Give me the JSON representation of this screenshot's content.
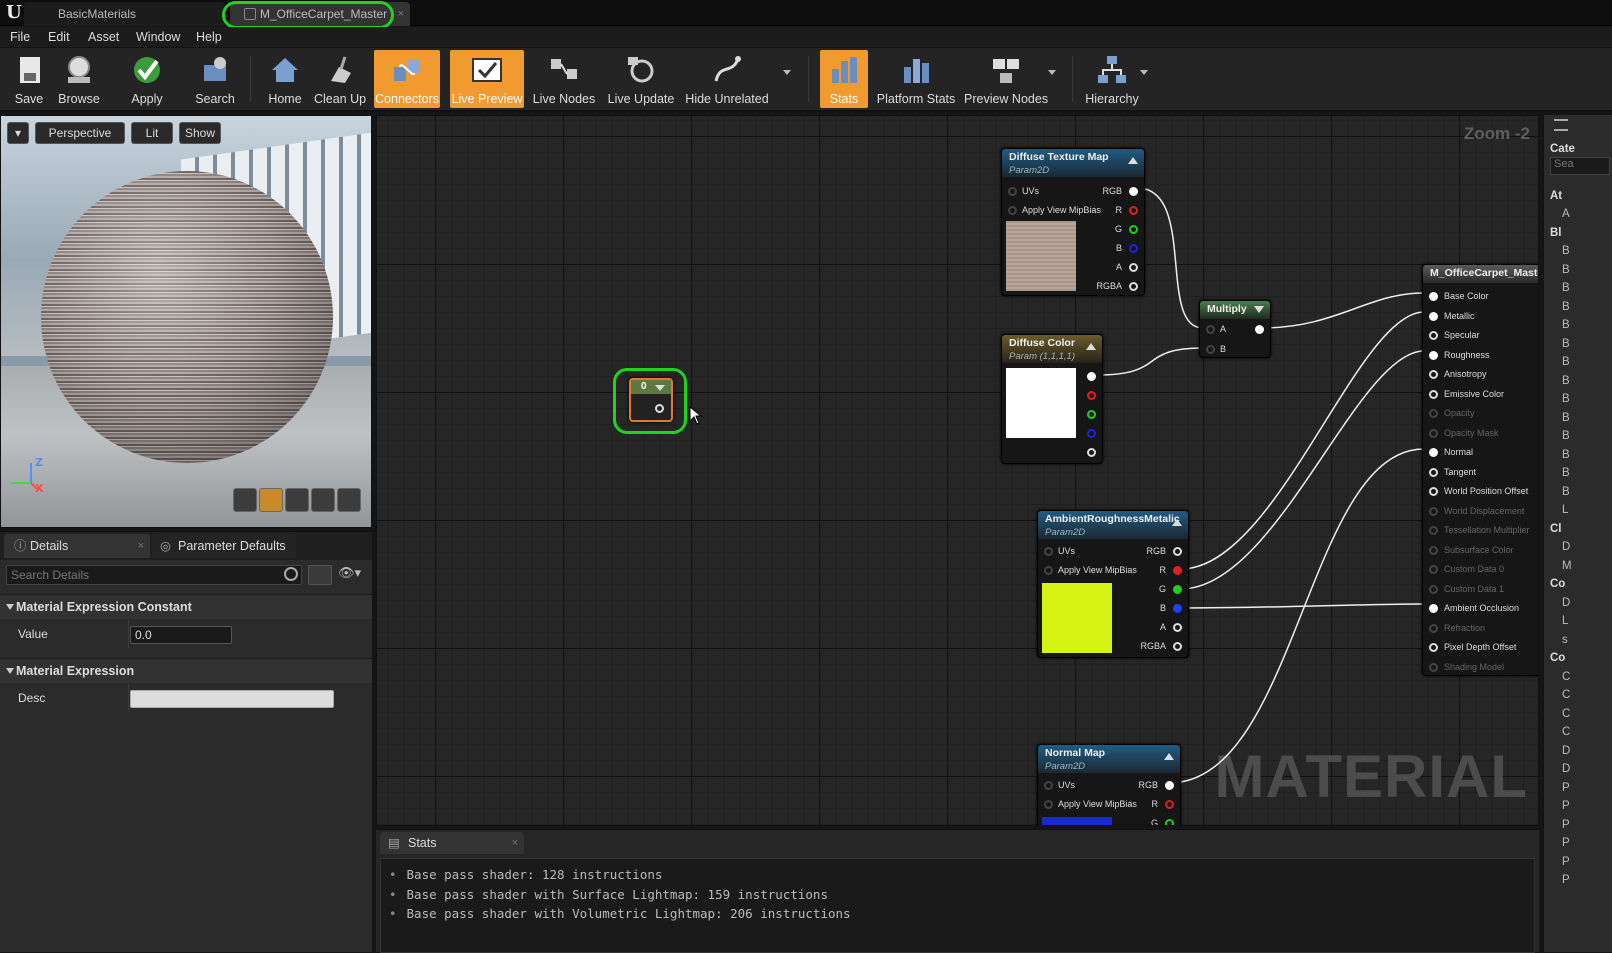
{
  "titlebar": {
    "tab1": "BasicMaterials",
    "tab2": "M_OfficeCarpet_Master",
    "close": "×"
  },
  "menu": [
    "File",
    "Edit",
    "Asset",
    "Window",
    "Help"
  ],
  "toolbar": {
    "save": "Save",
    "browse": "Browse",
    "apply": "Apply",
    "search": "Search",
    "home": "Home",
    "cleanup": "Clean Up",
    "connectors": "Connectors",
    "live_preview": "Live Preview",
    "live_nodes": "Live Nodes",
    "live_update": "Live Update",
    "hide_unrelated": "Hide Unrelated",
    "stats": "Stats",
    "platform_stats": "Platform Stats",
    "preview_nodes": "Preview Nodes",
    "hierarchy": "Hierarchy",
    "accent": "#f09a30"
  },
  "viewport": {
    "perspective": "Perspective",
    "lit": "Lit",
    "show": "Show",
    "axis_z": "Z",
    "axis_x": "X"
  },
  "details": {
    "tab_details": "Details",
    "tab_params": "Parameter Defaults",
    "search_placeholder": "Search Details",
    "cat1": "Material Expression Constant",
    "value_label": "Value",
    "value": "0.0",
    "cat2": "Material Expression",
    "desc_label": "Desc",
    "desc_value": ""
  },
  "graph": {
    "zoom": "Zoom -2",
    "watermark": "MATERIAL",
    "const_node": {
      "value": "0"
    },
    "diffuse_tex": {
      "title": "Diffuse Texture Map",
      "sub": "Param2D",
      "in1": "UVs",
      "in2": "Apply View MipBias",
      "o1": "RGB",
      "o2": "R",
      "o3": "G",
      "o4": "B",
      "o5": "A",
      "o6": "RGBA"
    },
    "diffuse_color": {
      "title": "Diffuse Color",
      "sub": "Param (1,1,1,1)"
    },
    "multiply": {
      "title": "Multiply",
      "a": "A",
      "b": "B"
    },
    "arm": {
      "title": "AmbientRoughnessMetalic",
      "sub": "Param2D",
      "in1": "UVs",
      "in2": "Apply View MipBias",
      "o1": "RGB",
      "o2": "R",
      "o3": "G",
      "o4": "B",
      "o5": "A",
      "o6": "RGBA"
    },
    "normal": {
      "title": "Normal Map",
      "sub": "Param2D",
      "in1": "UVs",
      "in2": "Apply View MipBias",
      "o1": "RGB",
      "o2": "R",
      "o3": "G"
    },
    "result": {
      "title": "M_OfficeCarpet_Master",
      "pins": [
        "Base Color",
        "Metallic",
        "Specular",
        "Roughness",
        "Anisotropy",
        "Emissive Color",
        "Opacity",
        "Opacity Mask",
        "Normal",
        "Tangent",
        "World Position Offset",
        "World Displacement",
        "Tessellation Multiplier",
        "Subsurface Color",
        "Custom Data 0",
        "Custom Data 1",
        "Ambient Occlusion",
        "Refraction",
        "Pixel Depth Offset",
        "Shading Model"
      ]
    }
  },
  "stats": {
    "tab": "Stats",
    "lines": [
      "Base pass shader: 128 instructions",
      "Base pass shader with Surface Lightmap: 159 instructions",
      "Base pass shader with Volumetric Lightmap: 206 instructions"
    ]
  },
  "right_panel": {
    "search": "Sea",
    "items": [
      "Cate",
      "At",
      "A",
      "Bl",
      "B",
      "B",
      "B",
      "B",
      "B",
      "B",
      "B",
      "B",
      "B",
      "B",
      "B",
      "B",
      "B",
      "B",
      "L",
      "Cl",
      "D",
      "M",
      "Co",
      "D",
      "L",
      "s",
      "Co",
      "C",
      "C",
      "C",
      "C",
      "D",
      "D",
      "P",
      "P",
      "P",
      "P",
      "P",
      "P"
    ]
  }
}
